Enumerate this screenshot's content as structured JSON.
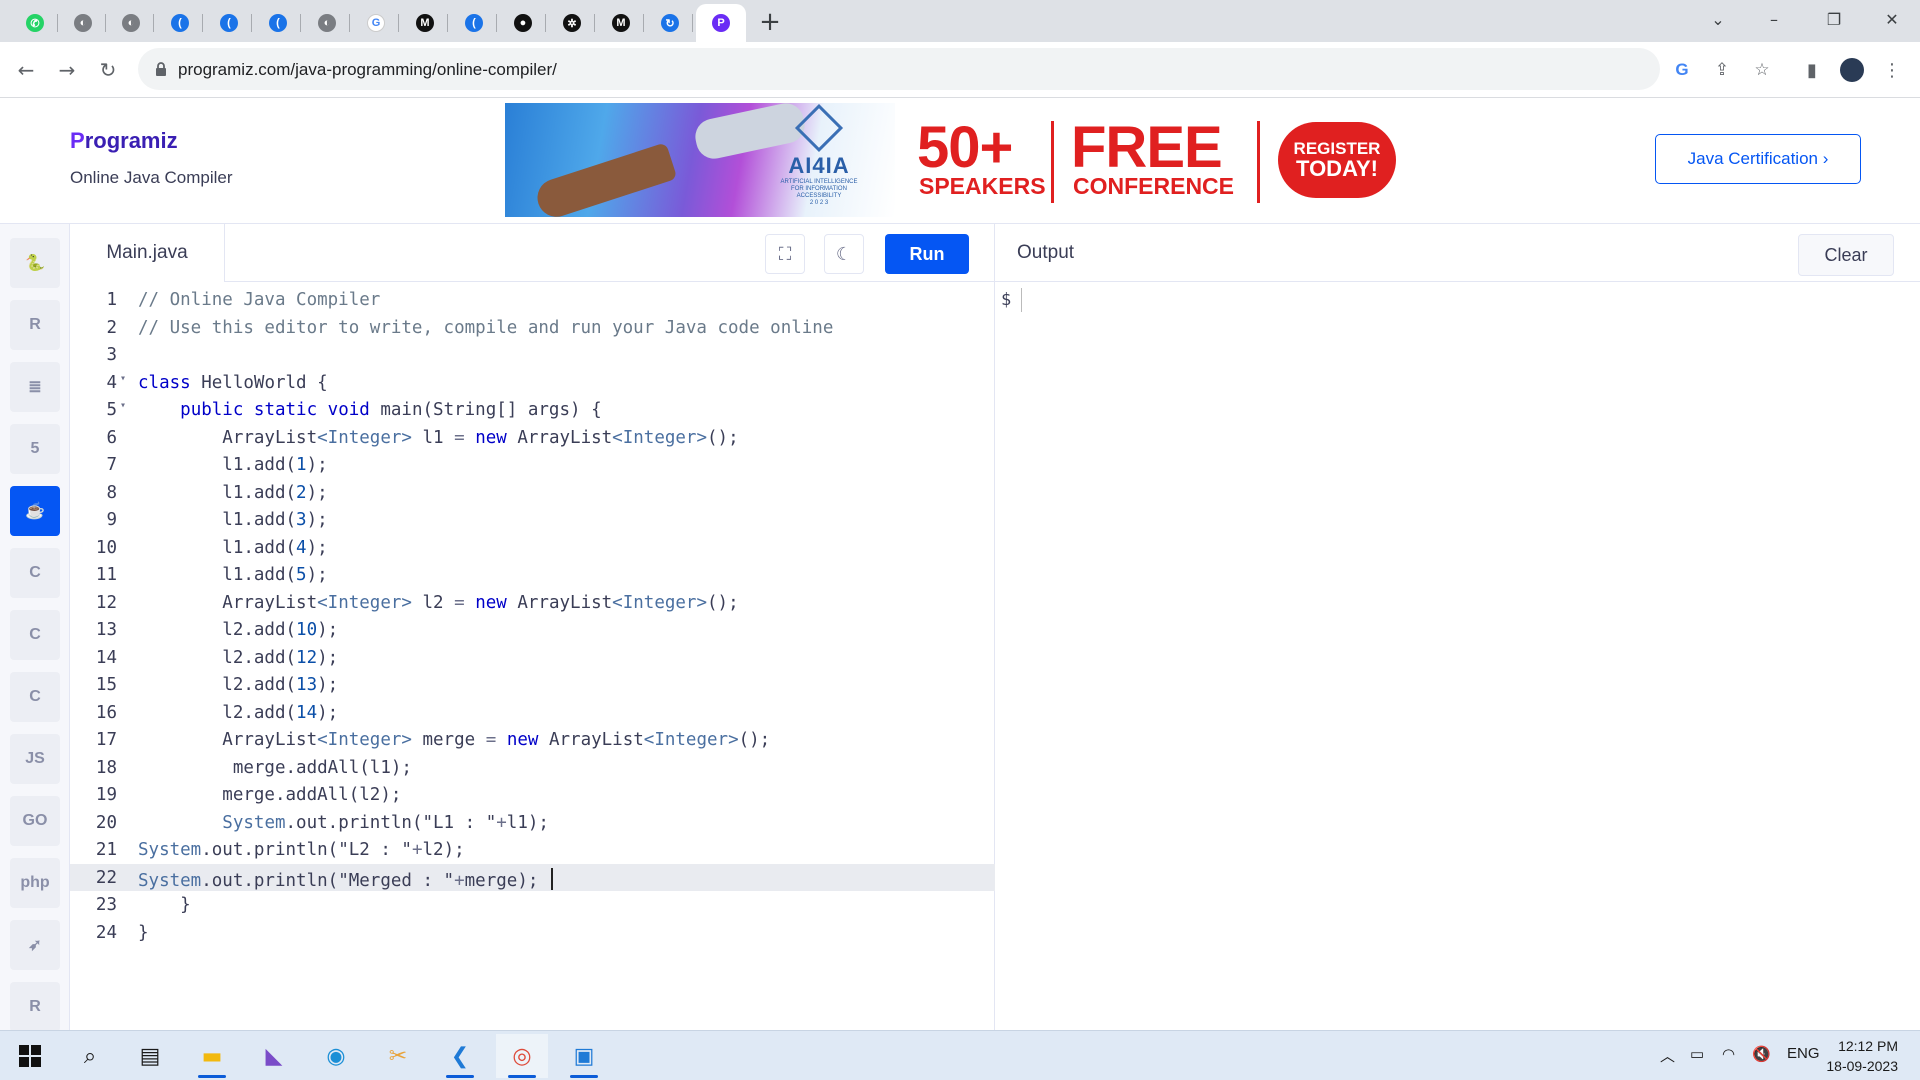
{
  "browser": {
    "tabs": [
      {
        "icon": "whatsapp-icon",
        "color": "#25d366",
        "glyph": "✆"
      },
      {
        "icon": "globe-icon",
        "color": "#7a7d82",
        "glyph": "◐"
      },
      {
        "icon": "globe-icon",
        "color": "#7a7d82",
        "glyph": "◐"
      },
      {
        "icon": "crescent-icon",
        "color": "#1a73e8",
        "glyph": "("
      },
      {
        "icon": "crescent-icon",
        "color": "#1a73e8",
        "glyph": "("
      },
      {
        "icon": "crescent-icon",
        "color": "#1a73e8",
        "glyph": "("
      },
      {
        "icon": "globe-icon",
        "color": "#7a7d82",
        "glyph": "◐"
      },
      {
        "icon": "google-icon",
        "color": "#ffffff",
        "glyph": "G"
      },
      {
        "icon": "medium-icon",
        "color": "#111111",
        "glyph": "M"
      },
      {
        "icon": "crescent-icon",
        "color": "#1a73e8",
        "glyph": "("
      },
      {
        "icon": "github-icon",
        "color": "#111111",
        "glyph": "●"
      },
      {
        "icon": "openai-icon",
        "color": "#111111",
        "glyph": "✲"
      },
      {
        "icon": "medium-icon",
        "color": "#111111",
        "glyph": "M"
      },
      {
        "icon": "sync-icon",
        "color": "#1a73e8",
        "glyph": "↻"
      },
      {
        "icon": "programiz-icon",
        "color": "#6a2cf5",
        "glyph": "P"
      }
    ],
    "url": "programiz.com/java-programming/online-compiler/"
  },
  "site": {
    "brand": "rogramiz",
    "brand_letter": "P",
    "subtitle": "Online Java Compiler",
    "cert_button": "Java Certification ›"
  },
  "ad": {
    "logo": "AI4IA",
    "logo_small": "ARTIFICIAL INTELLIGENCE FOR INFORMATION ACCESSIBILITY",
    "logo_year": "2 0 2 3",
    "big1": "50+",
    "small1": "SPEAKERS",
    "big2": "FREE",
    "small2": "CONFERENCE",
    "cta1": "REGISTER",
    "cta2": "TODAY!"
  },
  "rail": [
    {
      "name": "python",
      "label": "🐍"
    },
    {
      "name": "r",
      "label": "R"
    },
    {
      "name": "sql",
      "label": "≣"
    },
    {
      "name": "html",
      "label": "5"
    },
    {
      "name": "java",
      "label": "☕",
      "active": true
    },
    {
      "name": "c",
      "label": "C"
    },
    {
      "name": "cpp",
      "label": "C"
    },
    {
      "name": "csharp",
      "label": "C"
    },
    {
      "name": "js",
      "label": "JS"
    },
    {
      "name": "go",
      "label": "GO"
    },
    {
      "name": "php",
      "label": "php"
    },
    {
      "name": "swift",
      "label": "➶"
    },
    {
      "name": "rust",
      "label": "R"
    }
  ],
  "editor": {
    "file": "Main.java",
    "run": "Run",
    "current_line": 22,
    "lines": [
      {
        "n": "1",
        "text": "// Online Java Compiler",
        "kind": "comment"
      },
      {
        "n": "2",
        "text": "// Use this editor to write, compile and run your Java code online",
        "kind": "comment"
      },
      {
        "n": "3",
        "text": ""
      },
      {
        "n": "4",
        "fold": true,
        "parts": [
          [
            "kw",
            "class"
          ],
          [
            "",
            " HelloWorld {"
          ]
        ]
      },
      {
        "n": "5",
        "fold": true,
        "parts": [
          [
            "",
            "    "
          ],
          [
            "kw",
            "public static void"
          ],
          [
            "",
            " main(String[] args) {"
          ]
        ]
      },
      {
        "n": "6",
        "parts": [
          [
            "",
            "        ArrayList"
          ],
          [
            "ty",
            "<Integer>"
          ],
          [
            "",
            " l1 "
          ],
          [
            "op",
            "="
          ],
          [
            "",
            " "
          ],
          [
            "kw",
            "new"
          ],
          [
            "",
            " ArrayList"
          ],
          [
            "ty",
            "<Integer>"
          ],
          [
            "",
            "();"
          ]
        ]
      },
      {
        "n": "7",
        "parts": [
          [
            "",
            "        l1.add("
          ],
          [
            "num",
            "1"
          ],
          [
            "",
            ");"
          ]
        ]
      },
      {
        "n": "8",
        "parts": [
          [
            "",
            "        l1.add("
          ],
          [
            "num",
            "2"
          ],
          [
            "",
            ");"
          ]
        ]
      },
      {
        "n": "9",
        "parts": [
          [
            "",
            "        l1.add("
          ],
          [
            "num",
            "3"
          ],
          [
            "",
            ");"
          ]
        ]
      },
      {
        "n": "10",
        "parts": [
          [
            "",
            "        l1.add("
          ],
          [
            "num",
            "4"
          ],
          [
            "",
            ");"
          ]
        ]
      },
      {
        "n": "11",
        "parts": [
          [
            "",
            "        l1.add("
          ],
          [
            "num",
            "5"
          ],
          [
            "",
            ");"
          ]
        ]
      },
      {
        "n": "12",
        "parts": [
          [
            "",
            "        ArrayList"
          ],
          [
            "ty",
            "<Integer>"
          ],
          [
            "",
            " l2 "
          ],
          [
            "op",
            "="
          ],
          [
            "",
            " "
          ],
          [
            "kw",
            "new"
          ],
          [
            "",
            " ArrayList"
          ],
          [
            "ty",
            "<Integer>"
          ],
          [
            "",
            "();"
          ]
        ]
      },
      {
        "n": "13",
        "parts": [
          [
            "",
            "        l2.add("
          ],
          [
            "num",
            "10"
          ],
          [
            "",
            ");"
          ]
        ]
      },
      {
        "n": "14",
        "parts": [
          [
            "",
            "        l2.add("
          ],
          [
            "num",
            "12"
          ],
          [
            "",
            ");"
          ]
        ]
      },
      {
        "n": "15",
        "parts": [
          [
            "",
            "        l2.add("
          ],
          [
            "num",
            "13"
          ],
          [
            "",
            ");"
          ]
        ]
      },
      {
        "n": "16",
        "parts": [
          [
            "",
            "        l2.add("
          ],
          [
            "num",
            "14"
          ],
          [
            "",
            ");"
          ]
        ]
      },
      {
        "n": "17",
        "parts": [
          [
            "",
            "        ArrayList"
          ],
          [
            "ty",
            "<Integer>"
          ],
          [
            "",
            " merge "
          ],
          [
            "op",
            "="
          ],
          [
            "",
            " "
          ],
          [
            "kw",
            "new"
          ],
          [
            "",
            " ArrayList"
          ],
          [
            "ty",
            "<Integer>"
          ],
          [
            "",
            "();"
          ]
        ]
      },
      {
        "n": "18",
        "parts": [
          [
            "",
            "         merge.addAll(l1);"
          ]
        ]
      },
      {
        "n": "19",
        "parts": [
          [
            "",
            "        merge.addAll(l2);"
          ]
        ]
      },
      {
        "n": "20",
        "parts": [
          [
            "",
            "        "
          ],
          [
            "ty",
            "System"
          ],
          [
            "",
            ".out.println("
          ],
          [
            "str",
            "\"L1 : \""
          ],
          [
            "op",
            "+"
          ],
          [
            "",
            "l1);"
          ]
        ]
      },
      {
        "n": "21",
        "parts": [
          [
            "ty",
            "System"
          ],
          [
            "",
            ".out.println("
          ],
          [
            "str",
            "\"L2 : \""
          ],
          [
            "op",
            "+"
          ],
          [
            "",
            "l2);"
          ]
        ]
      },
      {
        "n": "22",
        "parts": [
          [
            "ty",
            "System"
          ],
          [
            "",
            ".out.println("
          ],
          [
            "str",
            "\"Merged : \""
          ],
          [
            "op",
            "+"
          ],
          [
            "",
            "merge); "
          ]
        ],
        "cursor": true
      },
      {
        "n": "23",
        "parts": [
          [
            "",
            "    }"
          ]
        ]
      },
      {
        "n": "24",
        "parts": [
          [
            "",
            "}"
          ]
        ]
      }
    ]
  },
  "output": {
    "title": "Output",
    "clear": "Clear",
    "prompt": "$"
  },
  "taskbar": {
    "lang": "ENG",
    "time": "12:12 PM",
    "date": "18-09-2023"
  },
  "colors": {
    "comment": "#6a7a8a",
    "kw": "#0000c8",
    "ty": "#4a6fa0",
    "num": "#0b4fa8",
    "str": "#3a3d56",
    "op": "#6b6f8a",
    "accent": "#0556f3"
  }
}
